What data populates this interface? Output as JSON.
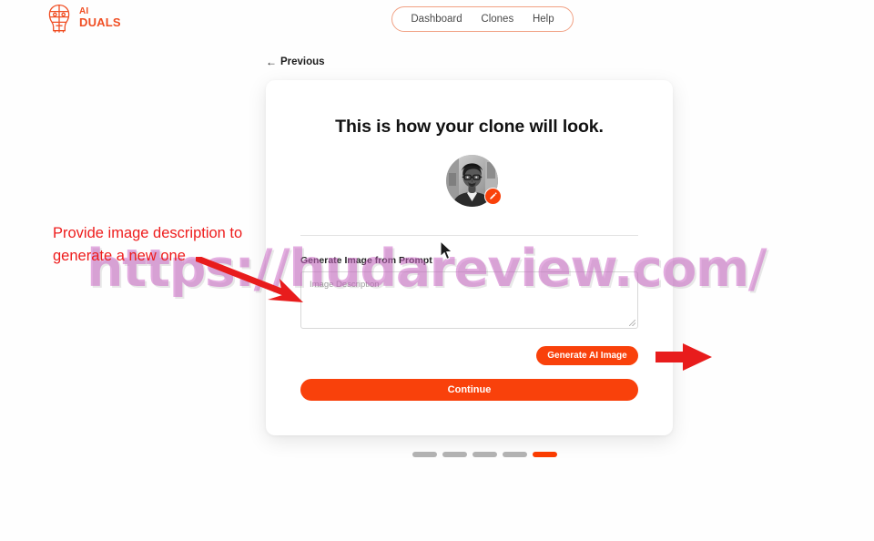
{
  "brand": {
    "icon": "ai-face-logo-icon",
    "line1": "AI",
    "line2": "DUALS",
    "color": "#F04E23"
  },
  "nav": {
    "items": [
      {
        "label": "Dashboard",
        "name": "nav-link-dashboard"
      },
      {
        "label": "Clones",
        "name": "nav-link-clones"
      },
      {
        "label": "Help",
        "name": "nav-link-help"
      }
    ],
    "border_color": "#F1A184"
  },
  "previous": {
    "arrow": "←",
    "label": "Previous"
  },
  "card": {
    "title": "This is how your clone will look.",
    "avatar_alt": "clone avatar photo",
    "edit_icon": "pencil-icon",
    "field_label": "Generate Image from Prompt",
    "textarea_placeholder": "Image Description",
    "textarea_value": "",
    "generate_button": "Generate AI Image",
    "continue_button": "Continue"
  },
  "steps": {
    "total": 5,
    "active_index": 5,
    "inactive_color": "#b2b2b2",
    "active_color": "#FA3C00"
  },
  "annotation": {
    "text": "Provide image description to generate a new one",
    "color": "#ee1c1c"
  },
  "watermark": {
    "text": "https://hudareview.com/",
    "color": "#c961c4"
  },
  "theme": {
    "accent": "#F9410B",
    "background": "#fefefe",
    "card_background": "#ffffff"
  }
}
